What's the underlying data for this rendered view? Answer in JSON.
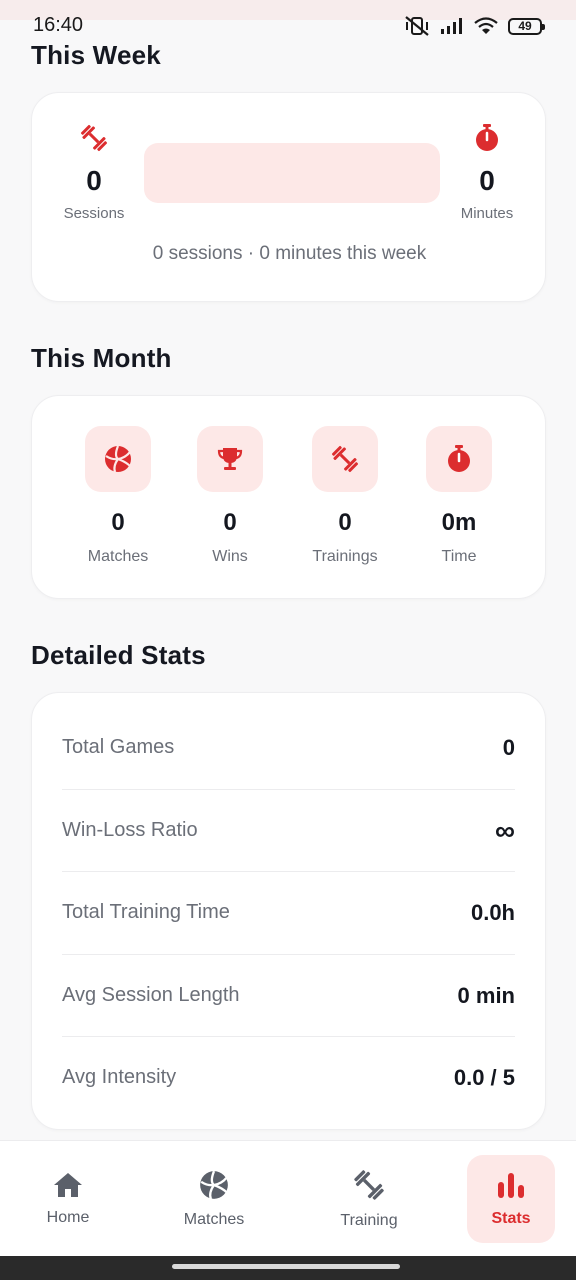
{
  "status_bar": {
    "time": "16:40",
    "battery": "49"
  },
  "colors": {
    "accent": "#dc2d2f",
    "accent_soft": "#fde8e7",
    "text": "#14171f",
    "muted": "#6b6f78"
  },
  "week": {
    "title": "This Week",
    "sessions_icon": "dumbbell-icon",
    "sessions_value": "0",
    "sessions_label": "Sessions",
    "minutes_icon": "stopwatch-icon",
    "minutes_value": "0",
    "minutes_label": "Minutes",
    "summary": "0 sessions · 0 minutes this week"
  },
  "month": {
    "title": "This Month",
    "items": [
      {
        "icon": "volleyball-icon",
        "value": "0",
        "label": "Matches"
      },
      {
        "icon": "trophy-icon",
        "value": "0",
        "label": "Wins"
      },
      {
        "icon": "dumbbell-icon",
        "value": "0",
        "label": "Trainings"
      },
      {
        "icon": "stopwatch-icon",
        "value": "0m",
        "label": "Time"
      }
    ]
  },
  "detailed": {
    "title": "Detailed Stats",
    "rows": [
      {
        "label": "Total Games",
        "value": "0"
      },
      {
        "label": "Win-Loss Ratio",
        "value": "∞"
      },
      {
        "label": "Total Training Time",
        "value": "0.0h"
      },
      {
        "label": "Avg Session Length",
        "value": "0 min"
      },
      {
        "label": "Avg Intensity",
        "value": "0.0 / 5"
      }
    ]
  },
  "nav": {
    "items": [
      {
        "icon": "home-icon",
        "label": "Home"
      },
      {
        "icon": "volleyball-icon",
        "label": "Matches"
      },
      {
        "icon": "dumbbell-icon",
        "label": "Training"
      },
      {
        "icon": "bar-chart-icon",
        "label": "Stats",
        "active": true
      }
    ]
  }
}
